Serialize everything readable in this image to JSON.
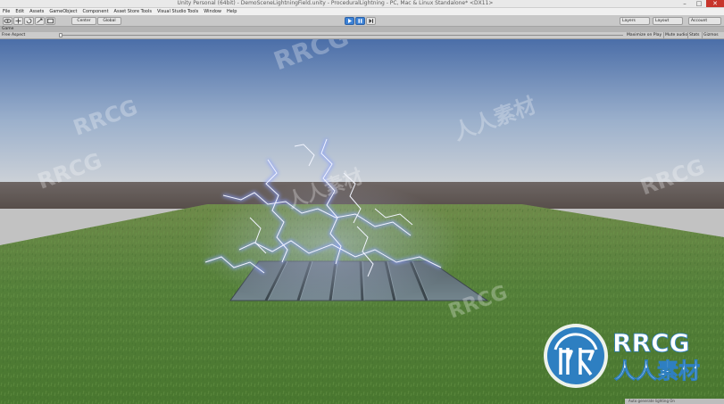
{
  "window": {
    "title": "Unity Personal (64bit) - DemoSceneLightningField.unity - ProceduralLightning - PC, Mac & Linux Standalone* <DX11>",
    "buttons": [
      "–",
      "□",
      "✕"
    ]
  },
  "menu": [
    "File",
    "Edit",
    "Assets",
    "GameObject",
    "Component",
    "Asset Store Tools",
    "Visual Studio Tools",
    "Window",
    "Help"
  ],
  "toolbar": {
    "pivot": "Center",
    "space": "Global",
    "layers": "Layers",
    "layout": "Layout",
    "account": "Account"
  },
  "game_tab": {
    "label": "Game"
  },
  "game_bar": {
    "aspect": "Free Aspect",
    "buttons": [
      "Maximize on Play",
      "Mute audio",
      "Stats",
      "Gizmos"
    ]
  },
  "status": {
    "text": "Auto generate lighting On"
  },
  "watermarks": [
    "RRCG",
    "人人素材"
  ],
  "colors": {
    "sky_top": "#4b6ea8",
    "grass": "#53813a",
    "lightning": "#dbe5ff",
    "accent": "#3c82d6"
  }
}
